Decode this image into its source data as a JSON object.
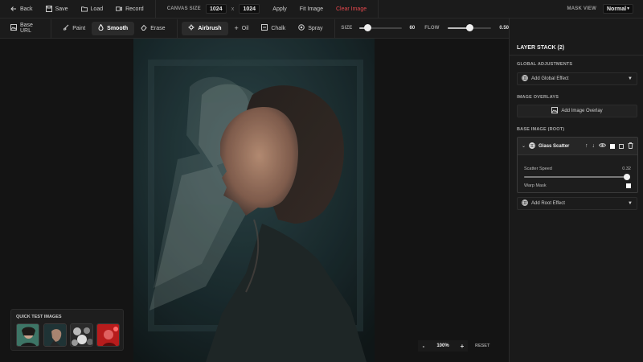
{
  "topbar": {
    "back": "Back",
    "save": "Save",
    "load": "Load",
    "record": "Record",
    "canvas_size_label": "CANVAS SIZE",
    "width": "1024",
    "times": "x",
    "height": "1024",
    "apply": "Apply",
    "fit_image": "Fit Image",
    "clear_image": "Clear Image",
    "mask_view_label": "MASK VIEW",
    "mask_view_value": "Normal"
  },
  "toolbar": {
    "base_url": "Base URL",
    "paint": "Paint",
    "smooth": "Smooth",
    "erase": "Erase",
    "airbrush": "Airbrush",
    "oil": "Oil",
    "chalk": "Chalk",
    "spray": "Spray",
    "size_label": "SIZE",
    "size_value": "60",
    "size_fraction": 0.2,
    "flow_label": "FLOW",
    "flow_value": "0.50",
    "flow_fraction": 0.5
  },
  "panel": {
    "title": "LAYER STACK (2)",
    "global_adjustments": "GLOBAL ADJUSTMENTS",
    "add_global_effect": "Add Global Effect",
    "image_overlays": "IMAGE OVERLAYS",
    "add_image_overlay": "Add Image Overlay",
    "base_image": "BASE IMAGE (ROOT)",
    "layer_name": "Glass Scatter",
    "scatter_speed_label": "Scatter Speed",
    "scatter_speed_value": "0.32",
    "scatter_speed_fraction": 0.97,
    "warp_mask_label": "Warp Mask",
    "add_root_effect": "Add Root Effect"
  },
  "quick_test": {
    "title": "QUICK TEST IMAGES"
  },
  "zoom": {
    "minus": "-",
    "value": "100%",
    "plus": "+",
    "reset": "RESET"
  },
  "colors": {
    "accent_red": "#e5484d",
    "background": "#151515",
    "panel": "#1a1a1a"
  }
}
